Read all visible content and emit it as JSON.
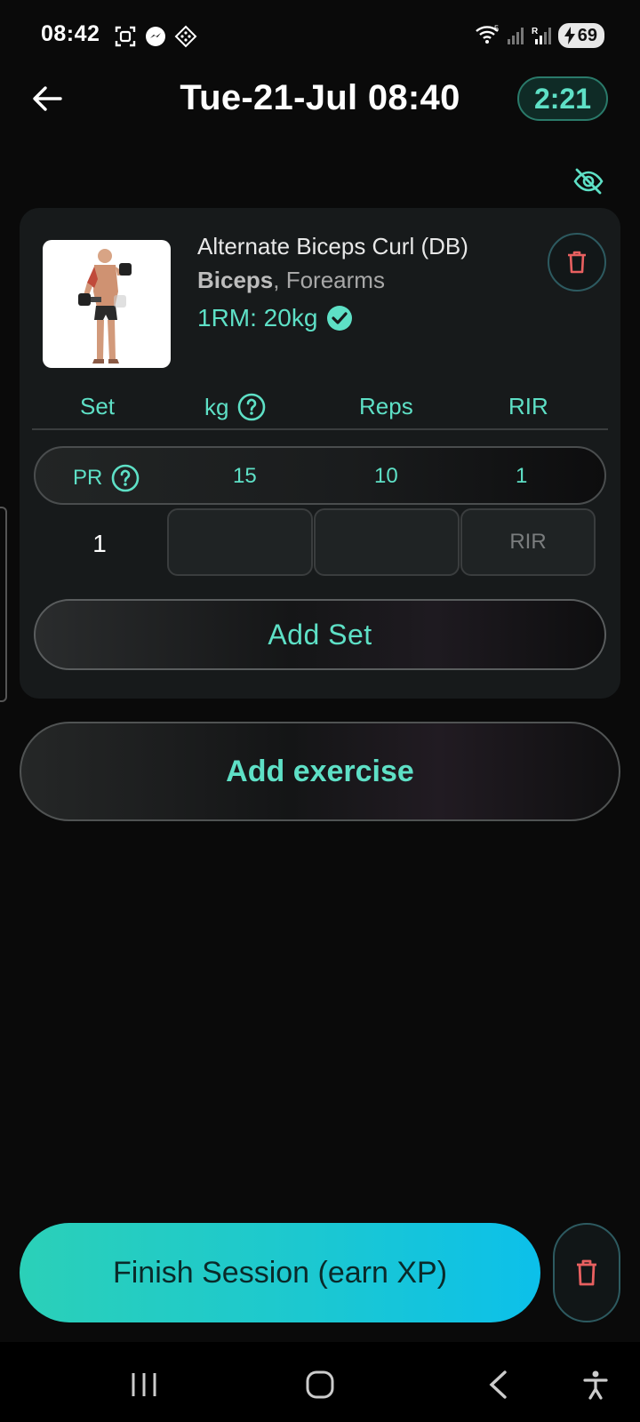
{
  "status_bar": {
    "time": "08:42",
    "battery": "69"
  },
  "header": {
    "title": "Tue-21-Jul 08:40",
    "timer": "2:21"
  },
  "exercise": {
    "name": "Alternate Biceps Curl (DB)",
    "primary_muscle": "Biceps",
    "secondary_muscle": ", Forearms",
    "one_rm": "1RM: 20kg"
  },
  "columns": {
    "set": "Set",
    "kg": "kg",
    "reps": "Reps",
    "rir": "RIR"
  },
  "pr_row": {
    "label": "PR",
    "kg": "15",
    "reps": "10",
    "rir": "1"
  },
  "set_row": {
    "number": "1",
    "kg_value": "",
    "reps_value": "",
    "rir_placeholder": "RIR"
  },
  "buttons": {
    "add_set": "Add Set",
    "add_exercise": "Add exercise",
    "finish": "Finish Session (earn XP)"
  },
  "colors": {
    "accent": "#5ee0c6",
    "danger": "#e86060",
    "background": "#0a0a0a"
  }
}
